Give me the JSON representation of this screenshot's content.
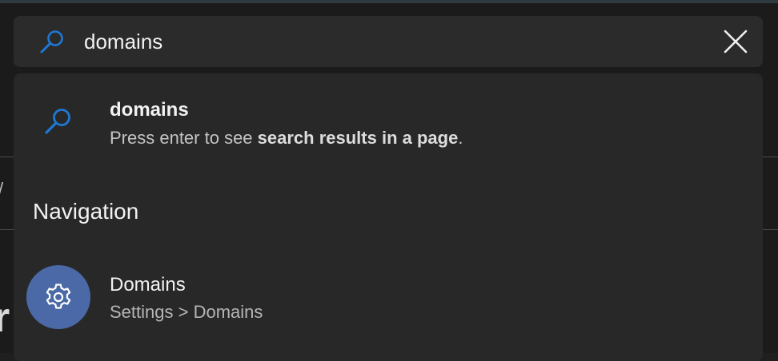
{
  "search": {
    "value": "domains",
    "icon": "search-icon",
    "close_icon": "close-icon"
  },
  "suggestion": {
    "query": "domains",
    "hint_prefix": "Press enter to see ",
    "hint_bold": "search results in a page",
    "hint_suffix": "."
  },
  "navigation": {
    "heading": "Navigation",
    "items": [
      {
        "title": "Domains",
        "path": "Settings > Domains",
        "icon": "gear-icon"
      }
    ]
  },
  "colors": {
    "accent_blue": "#1e78d6",
    "avatar_bg": "#4a69a6",
    "panel_bg": "#282828",
    "search_bg": "#2b2b2b"
  }
}
